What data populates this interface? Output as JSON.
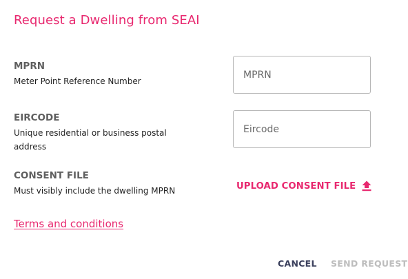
{
  "dialog": {
    "title": "Request a Dwelling from SEAI",
    "fields": [
      {
        "label": "MPRN",
        "description": "Meter Point Reference Number",
        "placeholder": "MPRN",
        "value": ""
      },
      {
        "label": "EIRCODE",
        "description": "Unique residential or business postal address",
        "placeholder": "Eircode",
        "value": ""
      }
    ],
    "consent": {
      "label": "CONSENT FILE",
      "description": "Must visibly include the dwelling MPRN",
      "upload_label": "UPLOAD CONSENT FILE",
      "upload_icon": "upload-icon"
    },
    "terms_link": "Terms and conditions",
    "actions": {
      "cancel": "CANCEL",
      "send": "SEND REQUEST"
    }
  },
  "colors": {
    "accent": "#e8286f",
    "label": "#5f5f5f",
    "cancel": "#3a3f5c",
    "disabled": "#bdbdbd"
  }
}
